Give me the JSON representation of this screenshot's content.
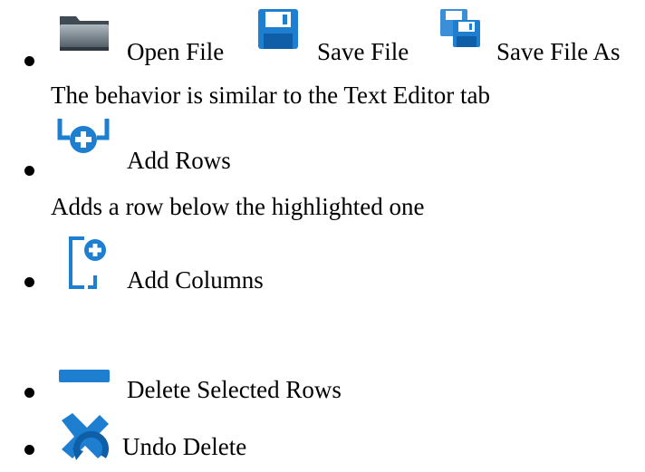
{
  "items": [
    {
      "actions": [
        {
          "label": "Open File",
          "icon": "folder-icon"
        },
        {
          "label": "Save File",
          "icon": "floppy-disk-icon"
        },
        {
          "label": "Save File As",
          "icon": "save-as-icon"
        }
      ],
      "description": "The behavior is similar to the Text Editor tab"
    },
    {
      "label": "Add Rows",
      "icon": "add-row-icon",
      "description": "Adds a row below the highlighted one"
    },
    {
      "label": "Add Columns",
      "icon": "add-column-icon"
    },
    {
      "label": "Delete Selected Rows",
      "icon": "delete-row-icon"
    },
    {
      "label": "Undo Delete",
      "icon": "undo-delete-icon"
    }
  ],
  "colors": {
    "accent_blue": "#1e7fd0",
    "folder_gray": "#5f6b74"
  }
}
